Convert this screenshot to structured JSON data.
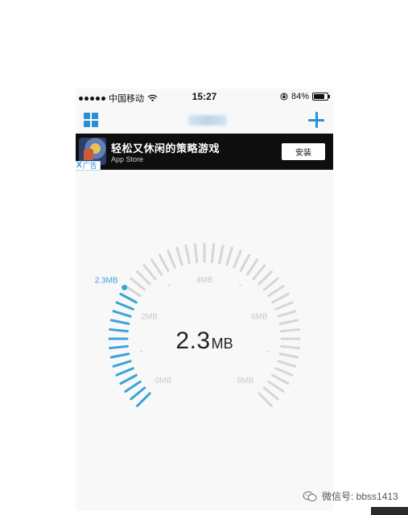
{
  "status_bar": {
    "carrier": "中国移动",
    "time": "15:27",
    "battery": "84%",
    "battery_level": 0.84
  },
  "ad": {
    "title": "轻松又休闲的策略游戏",
    "store": "App Store",
    "install_label": "安装",
    "tag_label": "广告",
    "close_symbol": "X"
  },
  "gauge": {
    "current_label": "2.3MB",
    "readout_value": "2.3",
    "readout_unit": "MB",
    "min": 0,
    "max": 8,
    "value": 2.3,
    "scale_labels": [
      {
        "value": 0,
        "text": "0MB"
      },
      {
        "value": 2,
        "text": "2MB"
      },
      {
        "value": 4,
        "text": "4MB"
      },
      {
        "value": 6,
        "text": "6MB"
      },
      {
        "value": 8,
        "text": "8MB"
      }
    ],
    "colors": {
      "active": "#3ba4d8",
      "inactive": "#d6d6d9",
      "label": "#c8c8cc",
      "current": "#3ba4d8"
    }
  },
  "watermark": {
    "text": "微信号: bbss1413",
    "icon": "wechat-icon"
  }
}
